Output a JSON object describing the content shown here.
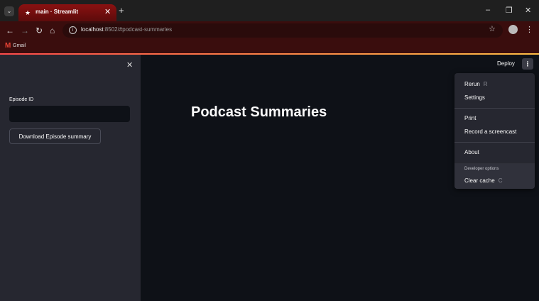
{
  "browser": {
    "tab_title": "main · Streamlit",
    "tab_favicon": "streamlit-icon",
    "url_host": "localhost",
    "url_path": ":8502/#podcast-summaries",
    "bookmarks": [
      {
        "label": "Gmail",
        "icon": "gmail-icon"
      }
    ]
  },
  "sidebar": {
    "episode_label": "Episode ID",
    "episode_value": "",
    "download_label": "Download Episode summary"
  },
  "main": {
    "title": "Podcast Summaries",
    "deploy_label": "Deploy"
  },
  "menu": {
    "rerun": {
      "label": "Rerun",
      "shortcut": "R"
    },
    "settings": "Settings",
    "print": "Print",
    "record": "Record a screencast",
    "about": "About",
    "dev_heading": "Developer options",
    "clear_cache": {
      "label": "Clear cache",
      "shortcut": "C"
    }
  },
  "colors": {
    "accent": "#ff4b4b",
    "sidebar_bg": "#262730",
    "main_bg": "#0e1117",
    "chrome_bg": "#3a0d0d"
  }
}
